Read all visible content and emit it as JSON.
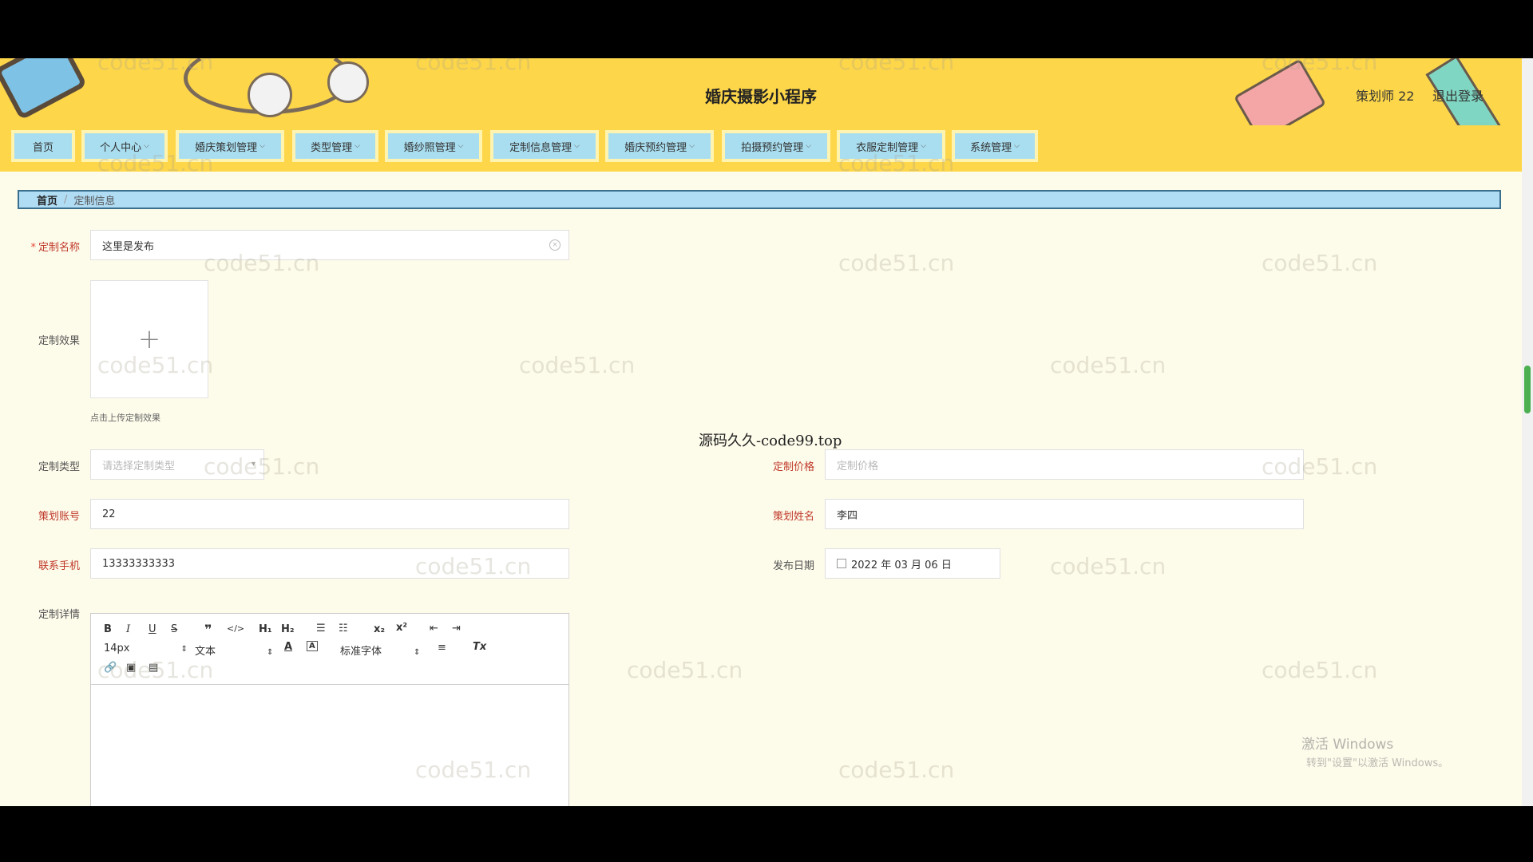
{
  "header": {
    "title": "婚庆摄影小程序",
    "user_name": "策划师 22",
    "logout_label": "退出登录"
  },
  "nav": {
    "items": [
      {
        "label": "首页"
      },
      {
        "label": "个人中心"
      },
      {
        "label": "婚庆策划管理"
      },
      {
        "label": "类型管理"
      },
      {
        "label": "婚纱照管理"
      },
      {
        "label": "定制信息管理"
      },
      {
        "label": "婚庆预约管理"
      },
      {
        "label": "拍摄预约管理"
      },
      {
        "label": "衣服定制管理"
      },
      {
        "label": "系统管理"
      }
    ]
  },
  "breadcrumb": {
    "home": "首页",
    "separator": "/",
    "current": "定制信息"
  },
  "form": {
    "name_label": "定制名称",
    "name_value": "这里是发布",
    "effect_label": "定制效果",
    "upload_hint": "点击上传定制效果",
    "type_label": "定制类型",
    "type_placeholder": "请选择定制类型",
    "price_label": "定制价格",
    "price_placeholder": "定制价格",
    "account_label": "策划账号",
    "account_value": "22",
    "planner_name_label": "策划姓名",
    "planner_name_value": "李四",
    "phone_label": "联系手机",
    "phone_value": "13333333333",
    "date_label": "发布日期",
    "date_value": "2022 年 03 月 06 日",
    "detail_label": "定制详情"
  },
  "editor": {
    "font_size": "14px",
    "text_type": "文本",
    "font_family": "标准字体"
  },
  "overlay": {
    "center_watermark": "源码久久-code99.top",
    "watermark_text": "code51.cn",
    "windows_activate": "激活 Windows",
    "windows_activate_sub": "转到\"设置\"以激活 Windows。"
  }
}
